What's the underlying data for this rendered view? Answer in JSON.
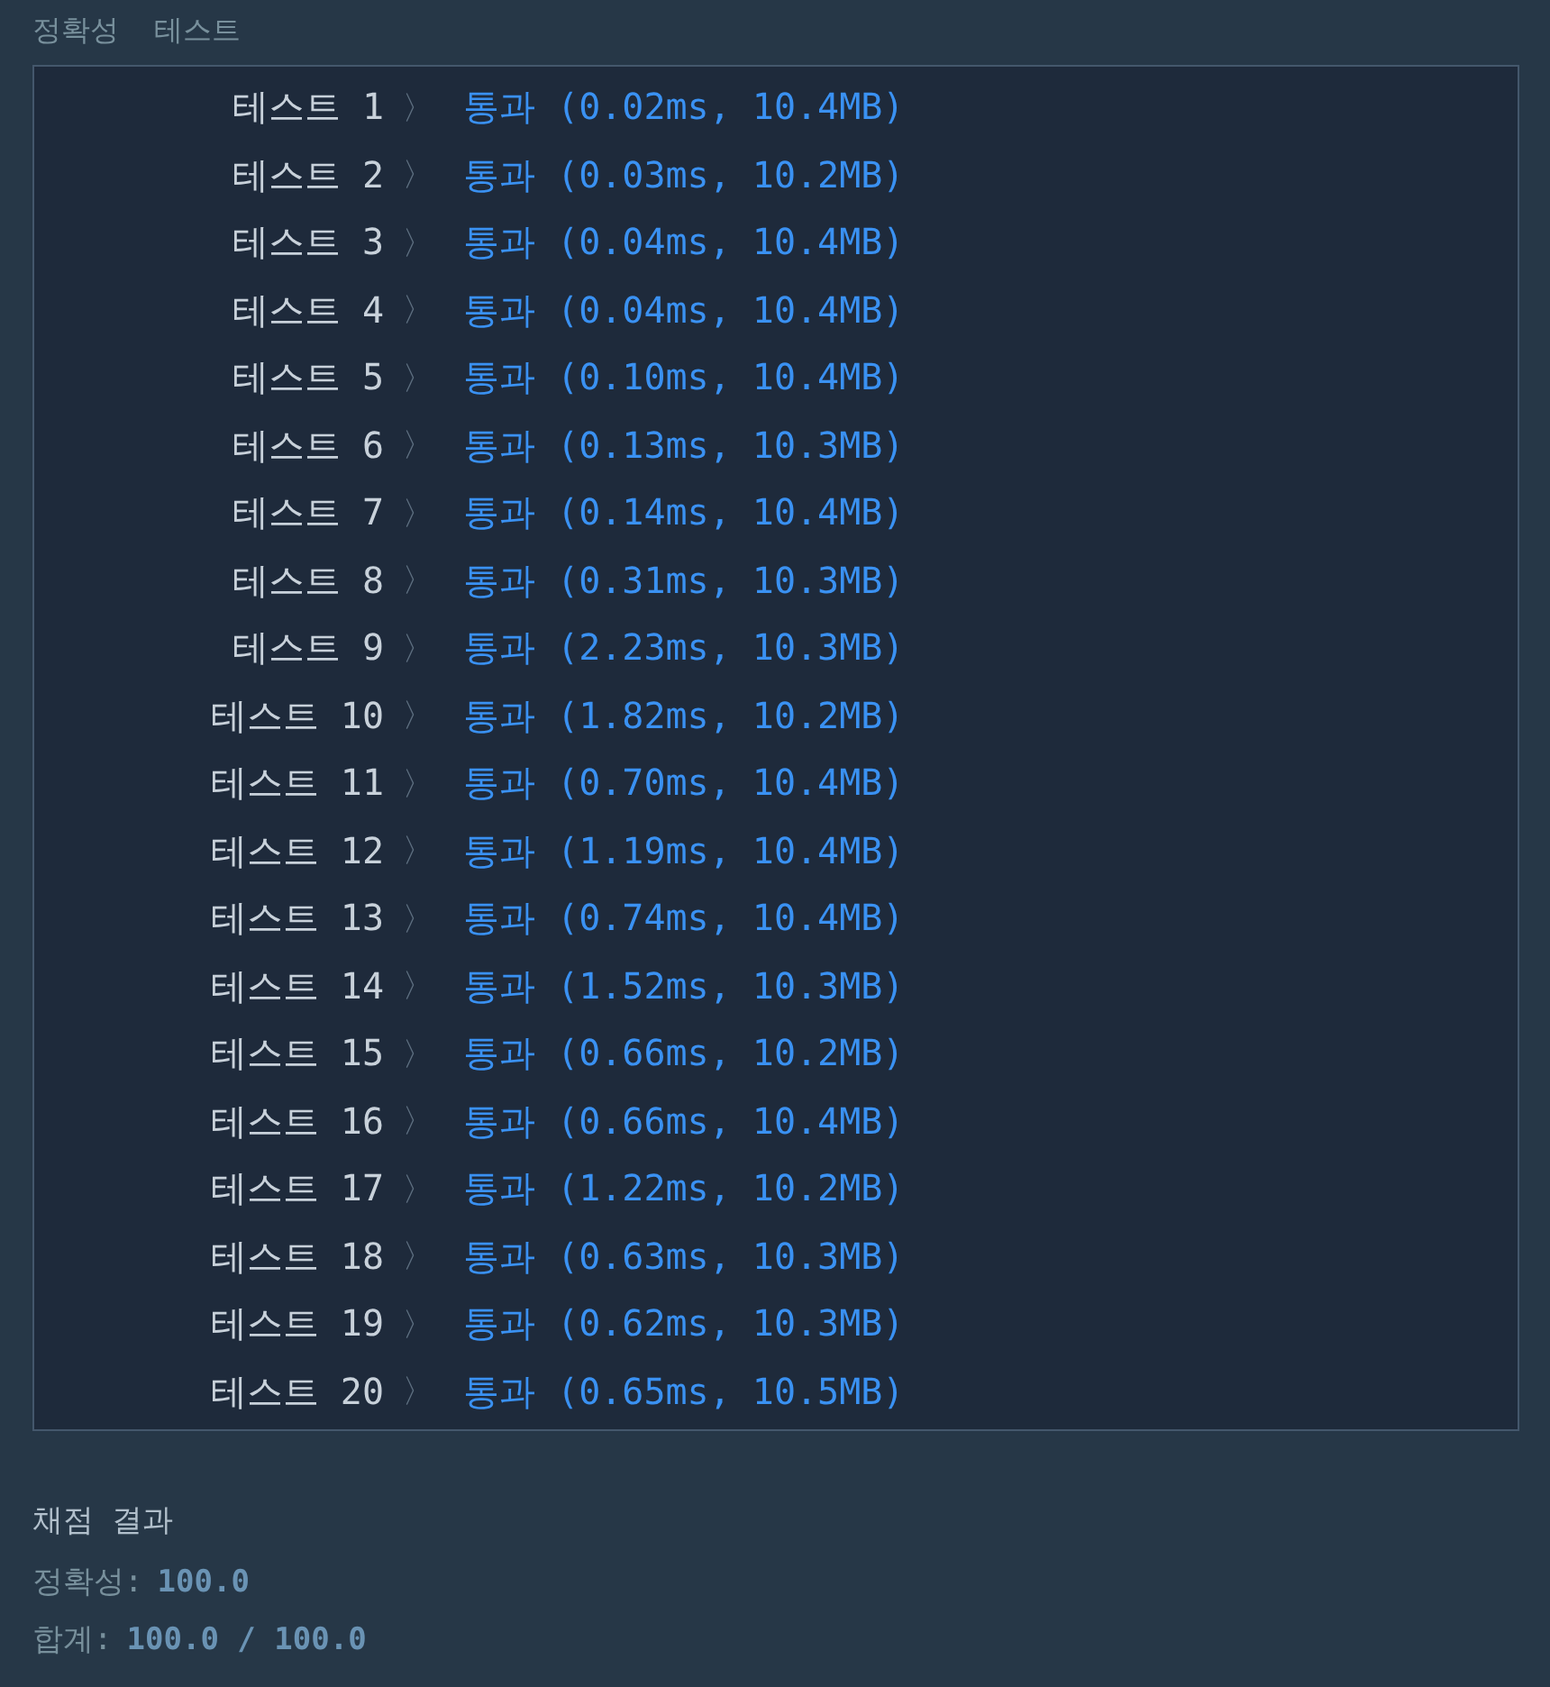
{
  "section_title": "정확성  테스트",
  "tests": [
    {
      "label": "테스트 1",
      "separator": "〉",
      "result": "통과 (0.02ms, 10.4MB)"
    },
    {
      "label": "테스트 2",
      "separator": "〉",
      "result": "통과 (0.03ms, 10.2MB)"
    },
    {
      "label": "테스트 3",
      "separator": "〉",
      "result": "통과 (0.04ms, 10.4MB)"
    },
    {
      "label": "테스트 4",
      "separator": "〉",
      "result": "통과 (0.04ms, 10.4MB)"
    },
    {
      "label": "테스트 5",
      "separator": "〉",
      "result": "통과 (0.10ms, 10.4MB)"
    },
    {
      "label": "테스트 6",
      "separator": "〉",
      "result": "통과 (0.13ms, 10.3MB)"
    },
    {
      "label": "테스트 7",
      "separator": "〉",
      "result": "통과 (0.14ms, 10.4MB)"
    },
    {
      "label": "테스트 8",
      "separator": "〉",
      "result": "통과 (0.31ms, 10.3MB)"
    },
    {
      "label": "테스트 9",
      "separator": "〉",
      "result": "통과 (2.23ms, 10.3MB)"
    },
    {
      "label": "테스트 10",
      "separator": "〉",
      "result": "통과 (1.82ms, 10.2MB)"
    },
    {
      "label": "테스트 11",
      "separator": "〉",
      "result": "통과 (0.70ms, 10.4MB)"
    },
    {
      "label": "테스트 12",
      "separator": "〉",
      "result": "통과 (1.19ms, 10.4MB)"
    },
    {
      "label": "테스트 13",
      "separator": "〉",
      "result": "통과 (0.74ms, 10.4MB)"
    },
    {
      "label": "테스트 14",
      "separator": "〉",
      "result": "통과 (1.52ms, 10.3MB)"
    },
    {
      "label": "테스트 15",
      "separator": "〉",
      "result": "통과 (0.66ms, 10.2MB)"
    },
    {
      "label": "테스트 16",
      "separator": "〉",
      "result": "통과 (0.66ms, 10.4MB)"
    },
    {
      "label": "테스트 17",
      "separator": "〉",
      "result": "통과 (1.22ms, 10.2MB)"
    },
    {
      "label": "테스트 18",
      "separator": "〉",
      "result": "통과 (0.63ms, 10.3MB)"
    },
    {
      "label": "테스트 19",
      "separator": "〉",
      "result": "통과 (0.62ms, 10.3MB)"
    },
    {
      "label": "테스트 20",
      "separator": "〉",
      "result": "통과 (0.65ms, 10.5MB)"
    }
  ],
  "grading": {
    "title": "채점 결과",
    "lines": [
      {
        "label": "정확성:",
        "value": "100.0"
      },
      {
        "label": "합계:",
        "value": "100.0 / 100.0"
      }
    ]
  }
}
